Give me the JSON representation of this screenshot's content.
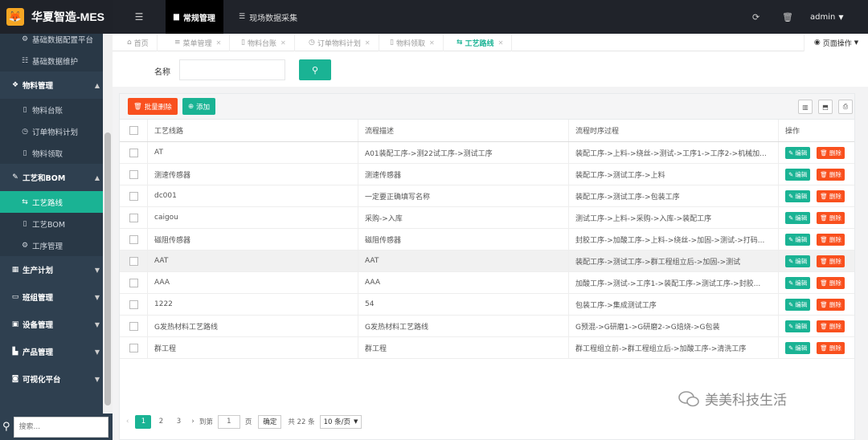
{
  "brand": {
    "logo_glyph": "🦊",
    "title": "华夏智造-MES"
  },
  "top_nav": [
    {
      "label": "常规管理",
      "icon": "file-icon"
    },
    {
      "label": "现场数据采集",
      "icon": "database-icon"
    }
  ],
  "top_right": {
    "user": "admin"
  },
  "sidebar": {
    "items": [
      {
        "label": "基础数据配置平台",
        "icon": "gear-icon",
        "type": "sub"
      },
      {
        "label": "基础数据维护",
        "icon": "list-icon",
        "type": "sub"
      },
      {
        "label": "物料管理",
        "icon": "cube-icon",
        "type": "group"
      },
      {
        "label": "物料台账",
        "icon": "doc-icon",
        "type": "sub"
      },
      {
        "label": "订单物料计划",
        "icon": "clock-icon",
        "type": "sub"
      },
      {
        "label": "物料领取",
        "icon": "doc-icon",
        "type": "sub"
      },
      {
        "label": "工艺和BOM",
        "icon": "wrench-icon",
        "type": "group"
      },
      {
        "label": "工艺路线",
        "icon": "route-icon",
        "type": "sub",
        "active": true
      },
      {
        "label": "工艺BOM",
        "icon": "doc-icon",
        "type": "sub"
      },
      {
        "label": "工序管理",
        "icon": "gear-icon",
        "type": "sub"
      },
      {
        "label": "生产计划",
        "icon": "calendar-icon",
        "type": "group"
      },
      {
        "label": "班组管理",
        "icon": "monitor-icon",
        "type": "group"
      },
      {
        "label": "设备管理",
        "icon": "device-icon",
        "type": "group"
      },
      {
        "label": "产品管理",
        "icon": "chart-icon",
        "type": "group"
      },
      {
        "label": "可视化平台",
        "icon": "camera-icon",
        "type": "group"
      }
    ],
    "search_placeholder": "搜索..."
  },
  "page_tabs": [
    {
      "label": "首页",
      "icon": "home-icon",
      "closable": false
    },
    {
      "label": "菜单管理",
      "icon": "menu-icon",
      "closable": true
    },
    {
      "label": "物料台账",
      "icon": "doc-icon",
      "closable": true
    },
    {
      "label": "订单物料计划",
      "icon": "clock-icon",
      "closable": true
    },
    {
      "label": "物料领取",
      "icon": "doc-icon",
      "closable": true
    },
    {
      "label": "工艺路线",
      "icon": "route-icon",
      "closable": true,
      "active": true
    }
  ],
  "page_ops_label": "页面操作",
  "search": {
    "label": "名称",
    "value": ""
  },
  "toolbar": {
    "delete_label": "批量删除",
    "add_label": "添加"
  },
  "table": {
    "headers": [
      "工艺线路",
      "流程描述",
      "流程时序过程",
      "操作"
    ],
    "rows": [
      {
        "route": "AT",
        "desc": "A01装配工序->测22试工序->测试工序",
        "process": "装配工序->上料->绕丝->测试->工序1->工序2->机械加..."
      },
      {
        "route": "测速传感器",
        "desc": "测速传感器",
        "process": "装配工序->测试工序->上料"
      },
      {
        "route": "dc001",
        "desc": "一定要正确填写名称",
        "process": "装配工序->测试工序->包装工序"
      },
      {
        "route": "caigou",
        "desc": "采购->入库",
        "process": "测试工序->上料->采购->入库->装配工序"
      },
      {
        "route": "磁阻传感器",
        "desc": "磁阻传感器",
        "process": "封胶工序->加酸工序->上料->绕丝->加固->测试->打码..."
      },
      {
        "route": "AAT",
        "desc": "AAT",
        "process": "装配工序->测试工序->群工程组立后->加固->测试"
      },
      {
        "route": "AAA",
        "desc": "AAA",
        "process": "加酸工序->测试->工序1->装配工序->测试工序->封胶..."
      },
      {
        "route": "1222",
        "desc": "54",
        "process": "包装工序->集成测试工序"
      },
      {
        "route": "G发热材料工艺路线",
        "desc": "G发热材料工艺路线",
        "process": "G预混->G研磨1->G研磨2->G焙烧->G包装"
      },
      {
        "route": "群工程",
        "desc": "群工程",
        "process": "群工程组立前->群工程组立后->加酸工序->清洗工序"
      }
    ],
    "edit_label": "编辑",
    "delete_label": "删除"
  },
  "pager": {
    "pages": [
      "1",
      "2",
      "3"
    ],
    "goto_prefix": "到第",
    "goto_value": "1",
    "goto_suffix": "页",
    "confirm": "确定",
    "total": "共 22 条",
    "page_size": "10 条/页"
  },
  "watermark": "美美科技生活",
  "colors": {
    "accent": "#1ab394",
    "danger": "#f9501e",
    "sidebar": "#2f4050",
    "topbar": "#20232a"
  }
}
